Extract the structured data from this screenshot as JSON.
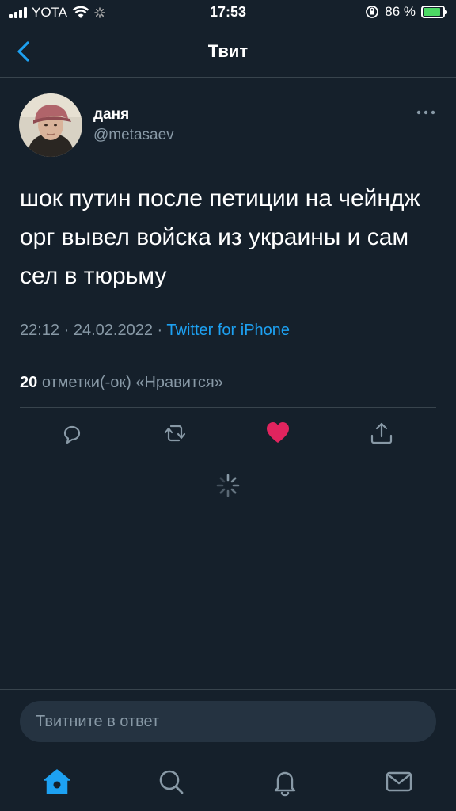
{
  "status_bar": {
    "carrier": "YOTA",
    "time": "17:53",
    "battery": "86 %",
    "battery_level": 0.86
  },
  "header": {
    "title": "Твит"
  },
  "tweet": {
    "author_name": "даня",
    "author_handle": "@metasaev",
    "text": "шок путин после петиции на чейндж орг вывел войска из украины и сам сел в тюрьму",
    "time": "22:12",
    "date": "24.02.2022",
    "separator": "·",
    "source": "Twitter for iPhone",
    "likes_count": "20",
    "likes_label": "отметки(-ок) «Нравится»"
  },
  "reply": {
    "placeholder": "Твитните в ответ"
  },
  "icons": {
    "back": "back-chevron-icon",
    "more": "more-dots-icon",
    "reply": "reply-icon",
    "retweet": "retweet-icon",
    "like": "heart-icon",
    "share": "share-icon",
    "home": "home-icon",
    "search": "search-icon",
    "notifications": "bell-icon",
    "messages": "mail-icon"
  },
  "colors": {
    "background": "#15202b",
    "accent": "#1da1f2",
    "like": "#e0245e",
    "muted": "#8899a6"
  }
}
